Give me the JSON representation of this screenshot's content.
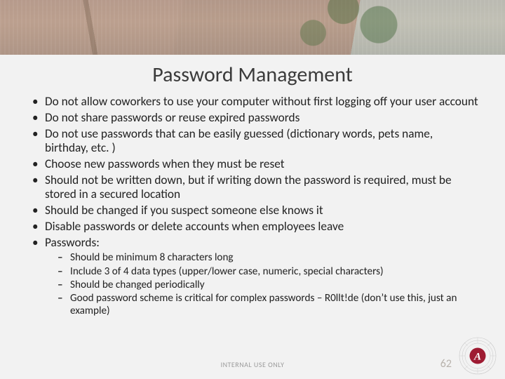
{
  "title": "Password Management",
  "bullets": [
    "Do not allow coworkers to use your computer without first logging off your user account",
    "Do not share passwords or reuse expired passwords",
    "Do not use passwords that can be easily guessed (dictionary words, pets name, birthday, etc. )",
    "Choose new passwords when they must be reset",
    "Should not be written down, but if writing down the password is required, must be stored in a secured location",
    "Should be changed if you suspect someone else knows it",
    "Disable passwords or delete accounts when employees leave",
    "Passwords:"
  ],
  "sub_bullets": [
    "Should be minimum 8 characters long",
    "Include 3 of 4 data types (upper/lower case, numeric, special characters)",
    "Should be changed periodically",
    "Good password scheme is critical for complex passwords – R0llt!de (don’t use this, just an example)"
  ],
  "footer": "INTERNAL USE ONLY",
  "page_number": "62",
  "seal_letter": "A",
  "colors": {
    "crimson": "#9e1b32",
    "seal_ring": "#b8b8b8"
  }
}
